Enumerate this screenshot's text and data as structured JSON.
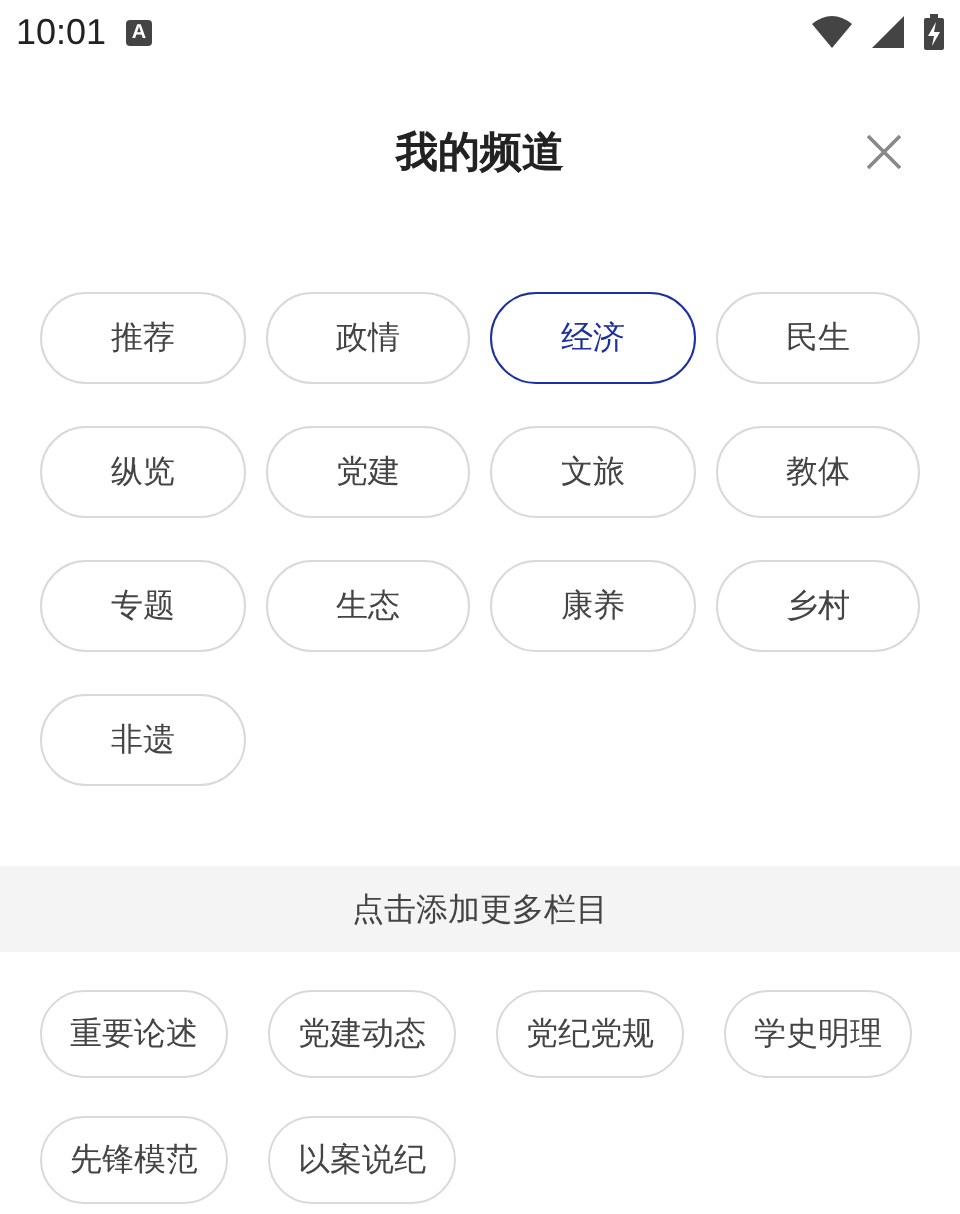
{
  "status_bar": {
    "time": "10:01",
    "badge": "A"
  },
  "header": {
    "title": "我的频道"
  },
  "my_channels": [
    {
      "label": "推荐",
      "selected": false
    },
    {
      "label": "政情",
      "selected": false
    },
    {
      "label": "经济",
      "selected": true
    },
    {
      "label": "民生",
      "selected": false
    },
    {
      "label": "纵览",
      "selected": false
    },
    {
      "label": "党建",
      "selected": false
    },
    {
      "label": "文旅",
      "selected": false
    },
    {
      "label": "教体",
      "selected": false
    },
    {
      "label": "专题",
      "selected": false
    },
    {
      "label": "生态",
      "selected": false
    },
    {
      "label": "康养",
      "selected": false
    },
    {
      "label": "乡村",
      "selected": false
    },
    {
      "label": "非遗",
      "selected": false
    }
  ],
  "add_section": {
    "title": "点击添加更多栏目",
    "channels": [
      {
        "label": "重要论述"
      },
      {
        "label": "党建动态"
      },
      {
        "label": "党纪党规"
      },
      {
        "label": "学史明理"
      },
      {
        "label": "先锋模范"
      },
      {
        "label": "以案说纪"
      }
    ]
  }
}
